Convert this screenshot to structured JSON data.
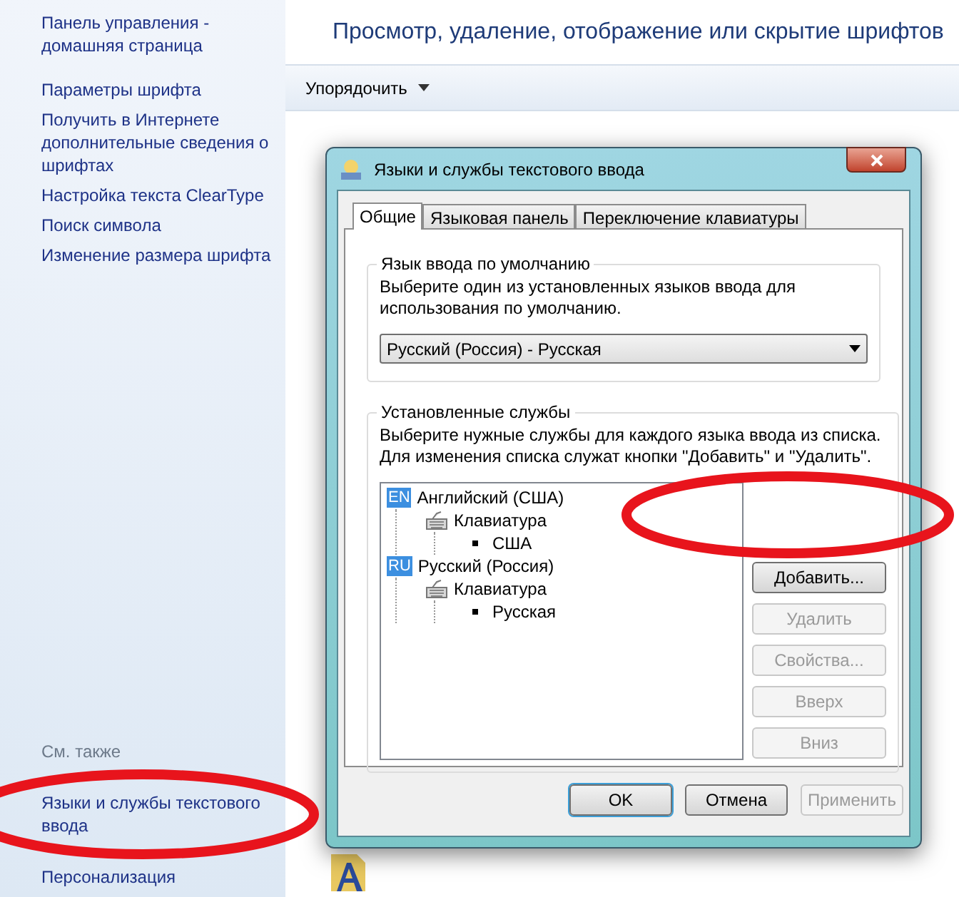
{
  "sidebar": {
    "links": [
      "Панель управления - домашняя страница",
      "Параметры шрифта",
      "Получить в Интернете дополнительные сведения о шрифтах",
      "Настройка текста ClearType",
      "Поиск символа",
      "Изменение размера шрифта"
    ],
    "see_also_title": "См. также",
    "see_also_links": [
      "Языки и службы текстового ввода",
      "Персонализация"
    ]
  },
  "header": {
    "title": "Просмотр, удаление, отображение или скрытие шрифтов"
  },
  "toolbar": {
    "organize": "Упорядочить"
  },
  "dialog": {
    "title": "Языки и службы текстового ввода",
    "tabs": [
      {
        "label": "Общие",
        "selected": true
      },
      {
        "label": "Языковая панель",
        "selected": false
      },
      {
        "label": "Переключение клавиатуры",
        "selected": false
      }
    ],
    "default_group": {
      "legend": "Язык ввода по умолчанию",
      "description": "Выберите один из установленных языков ввода для использования по умолчанию.",
      "select_value": "Русский (Россия) - Русская"
    },
    "services_group": {
      "legend": "Установленные службы",
      "description": "Выберите нужные службы для каждого языка ввода из списка. Для изменения списка служат кнопки \"Добавить\" и \"Удалить\".",
      "tree": [
        {
          "kind": "language",
          "badge": "EN",
          "label": "Английский (США)",
          "children": [
            {
              "kind": "keyboard",
              "label": "Клавиатура",
              "children": [
                {
                  "kind": "layout",
                  "label": "США"
                }
              ]
            }
          ]
        },
        {
          "kind": "language",
          "badge": "RU",
          "label": "Русский (Россия)",
          "children": [
            {
              "kind": "keyboard",
              "label": "Клавиатура",
              "children": [
                {
                  "kind": "layout",
                  "label": "Русская"
                }
              ]
            }
          ]
        }
      ],
      "buttons": [
        {
          "label": "Добавить...",
          "disabled": false
        },
        {
          "label": "Удалить",
          "disabled": true
        },
        {
          "label": "Свойства...",
          "disabled": true
        },
        {
          "label": "Вверх",
          "disabled": true
        },
        {
          "label": "Вниз",
          "disabled": true
        }
      ]
    },
    "footer_buttons": [
      {
        "label": "OK",
        "disabled": false,
        "default": true
      },
      {
        "label": "Отмена",
        "disabled": false,
        "default": false
      },
      {
        "label": "Применить",
        "disabled": true,
        "default": false
      }
    ]
  }
}
